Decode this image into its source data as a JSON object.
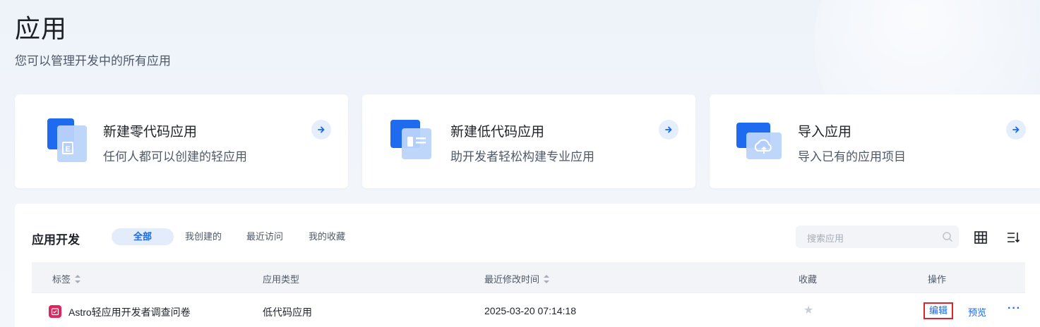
{
  "header": {
    "title": "应用",
    "subtitle": "您可以管理开发中的所有应用"
  },
  "cards": [
    {
      "title": "新建零代码应用",
      "desc": "任何人都可以创建的轻应用",
      "icon": "zero-code-app-icon"
    },
    {
      "title": "新建低代码应用",
      "desc": "助开发者轻松构建专业应用",
      "icon": "low-code-app-icon"
    },
    {
      "title": "导入应用",
      "desc": "导入已有的应用项目",
      "icon": "cloud-import-icon"
    }
  ],
  "panel": {
    "title": "应用开发",
    "tabs": [
      "全部",
      "我创建的",
      "最近访问",
      "我的收藏"
    ],
    "active_tab": "全部",
    "search_placeholder": "搜索应用"
  },
  "table": {
    "columns": [
      "标签",
      "应用类型",
      "最近修改时间",
      "收藏",
      "操作"
    ],
    "rows": [
      {
        "name": "Astro轻应用开发者调查问卷",
        "type": "低代码应用",
        "modified": "2025-03-20 07:14:18",
        "favorite": false,
        "actions": {
          "edit": "编辑",
          "preview": "预览",
          "more": "···"
        }
      }
    ]
  },
  "colors": {
    "accent": "#1b66e9",
    "app_icon": "#e0245e",
    "highlight_border": "#d9262c"
  }
}
